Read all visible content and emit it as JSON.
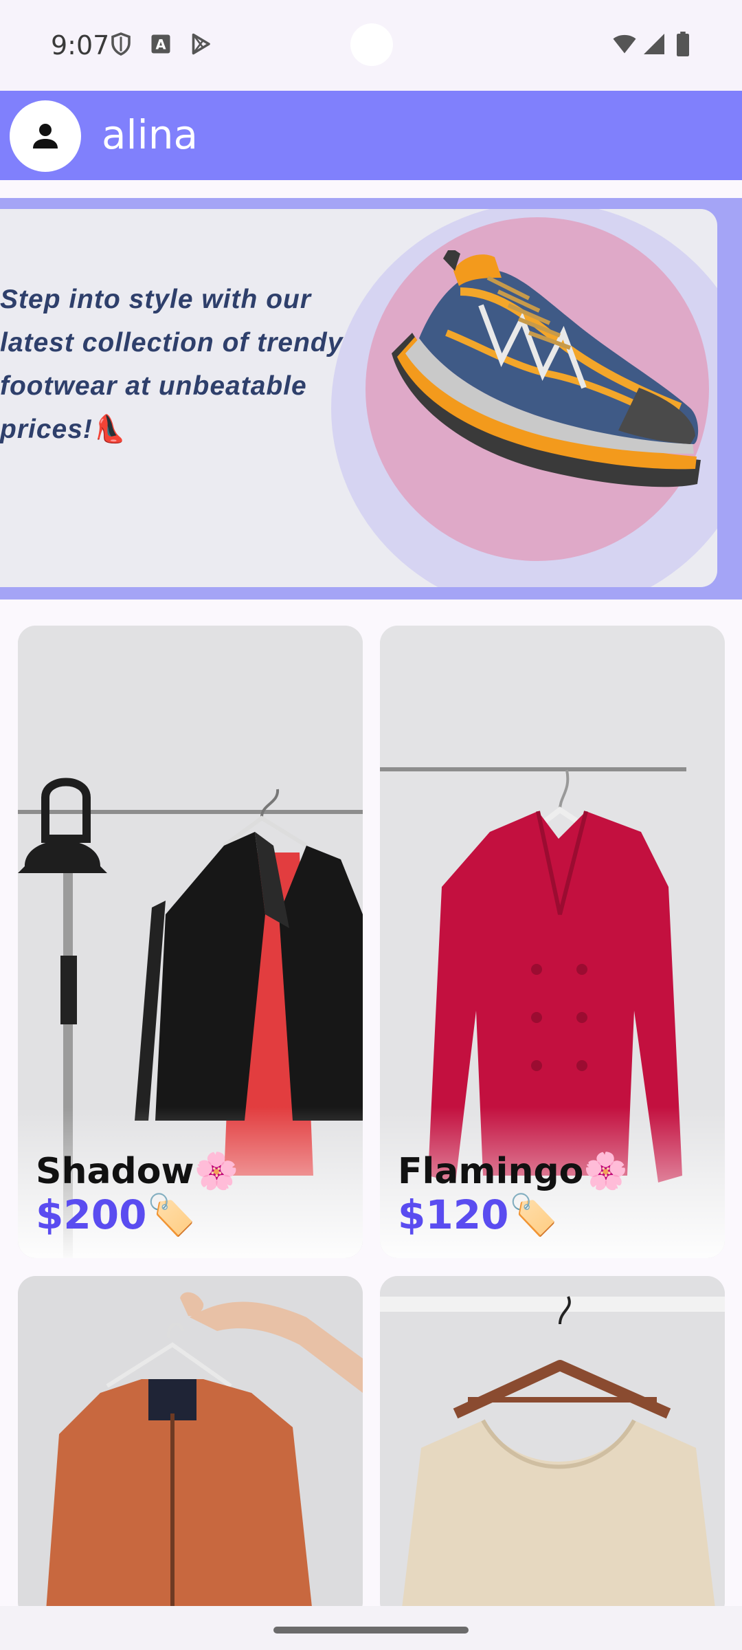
{
  "status_bar": {
    "time": "9:07",
    "left_icons": [
      "shield-icon",
      "keyboard-a-icon",
      "play-store-icon"
    ],
    "right_icons": [
      "wifi-icon",
      "cell-signal-icon",
      "battery-icon"
    ]
  },
  "app_bar": {
    "avatar_icon": "person-icon",
    "username": "alina"
  },
  "banner": {
    "text": "Step into style with our latest collection of trendy footwear at unbeatable prices!👠",
    "image": "sneaker-image"
  },
  "products": [
    {
      "name": "Shadow🌸",
      "price": "$200🏷️",
      "image": "black-blazer-image"
    },
    {
      "name": "Flamingo🌸",
      "price": "$120🏷️",
      "image": "red-blazer-image"
    },
    {
      "name": "",
      "price": "",
      "image": "orange-bomber-jacket-image"
    },
    {
      "name": "",
      "price": "",
      "image": "knit-sweater-image"
    }
  ],
  "colors": {
    "app_bar": "#8080fc",
    "banner_frame": "#a4a4f6",
    "price": "#5a4cf0",
    "banner_text": "#2e3f6b"
  }
}
